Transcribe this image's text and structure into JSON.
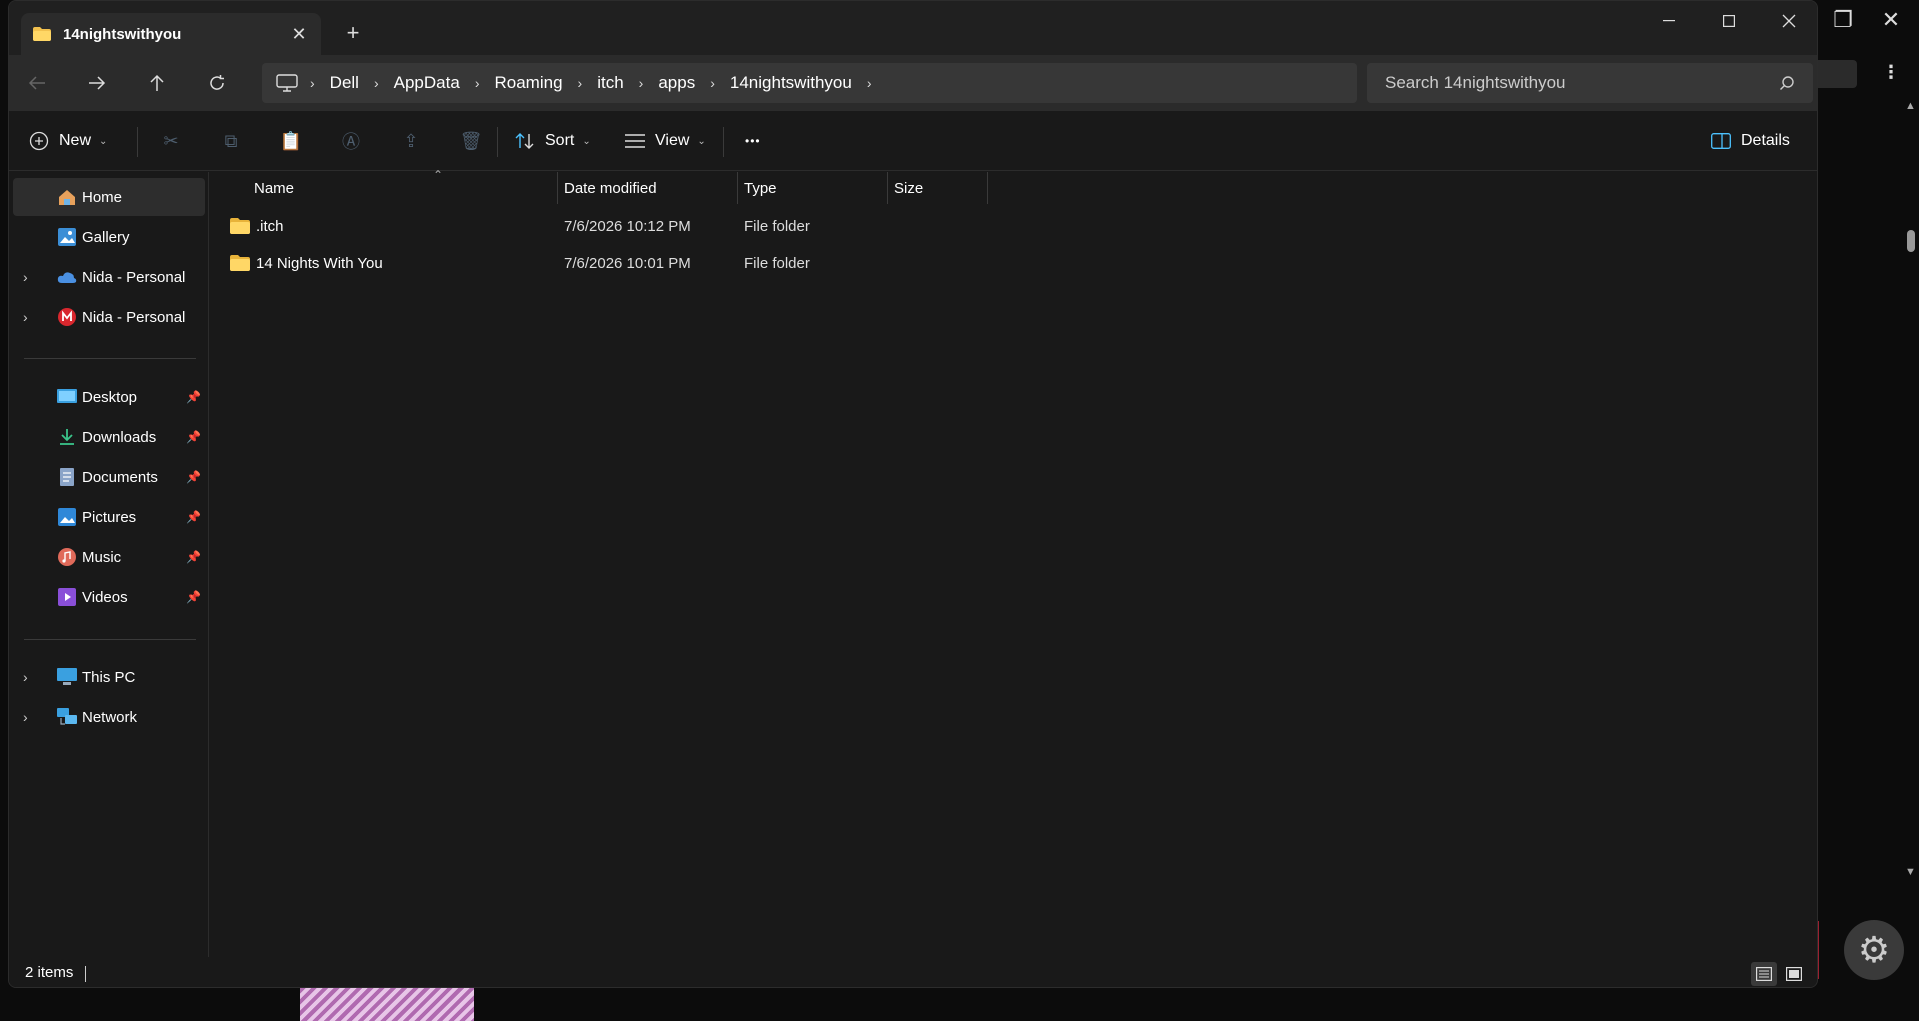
{
  "window": {
    "tab_title": "14nightswithyou",
    "new_tab": "+",
    "close_tab": "✕"
  },
  "nav": {
    "breadcrumbs": [
      "Dell",
      "AppData",
      "Roaming",
      "itch",
      "apps",
      "14nightswithyou"
    ],
    "search_placeholder": "Search 14nightswithyou"
  },
  "toolbar": {
    "new_label": "New",
    "sort_label": "Sort",
    "view_label": "View",
    "more_label": "•••",
    "details_label": "Details"
  },
  "sidebar": {
    "top_items": [
      {
        "label": "Home",
        "icon": "home-icon",
        "expandable": false,
        "active": true
      },
      {
        "label": "Gallery",
        "icon": "gallery-icon",
        "expandable": false
      },
      {
        "label": "Nida - Personal",
        "icon": "onedrive-icon",
        "expandable": true
      },
      {
        "label": "Nida - Personal",
        "icon": "mega-icon",
        "expandable": true
      }
    ],
    "pinned_items": [
      {
        "label": "Desktop",
        "icon": "desktop-icon"
      },
      {
        "label": "Downloads",
        "icon": "downloads-icon"
      },
      {
        "label": "Documents",
        "icon": "documents-icon"
      },
      {
        "label": "Pictures",
        "icon": "pictures-icon"
      },
      {
        "label": "Music",
        "icon": "music-icon"
      },
      {
        "label": "Videos",
        "icon": "videos-icon"
      }
    ],
    "bottom_items": [
      {
        "label": "This PC",
        "icon": "this-pc-icon"
      },
      {
        "label": "Network",
        "icon": "network-icon"
      }
    ]
  },
  "file_list": {
    "columns": [
      "Name",
      "Date modified",
      "Type",
      "Size"
    ],
    "rows": [
      {
        "name": ".itch",
        "date": "7/6/2026 10:12 PM",
        "type": "File folder",
        "size": ""
      },
      {
        "name": "14 Nights With You",
        "date": "7/6/2026 10:01 PM",
        "type": "File folder",
        "size": ""
      }
    ]
  },
  "status": {
    "item_count": "2 items"
  },
  "colors": {
    "window_bg": "#191919",
    "titlebar_bg": "#202020",
    "navbar_bg": "#2b2b2b",
    "folder_yellow": "#f2c14e",
    "accent_blue": "#4cc2ff"
  }
}
